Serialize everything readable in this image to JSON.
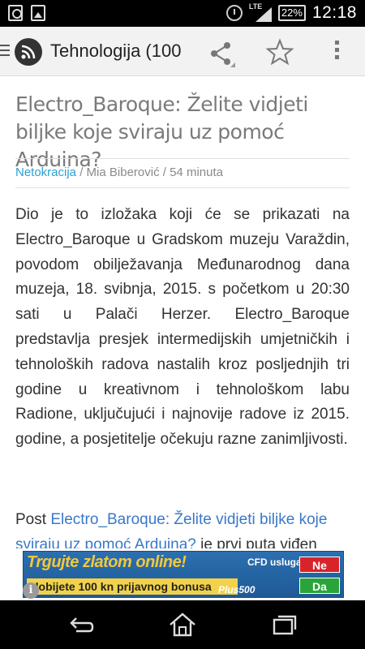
{
  "status_bar": {
    "network": "LTE",
    "battery": "22%",
    "time": "12:18"
  },
  "action_bar": {
    "title": "Tehnologija (100",
    "icons": [
      "rss-feed-icon",
      "share-icon",
      "star-icon",
      "overflow-menu-icon"
    ]
  },
  "article": {
    "title": "Electro_Baroque: Želite vidjeti biljke koje sviraju uz pomoć Arduina?",
    "source": "Netokracija",
    "separator": " / ",
    "author": "Mia Biberović",
    "time_ago": "54 minuta",
    "body": "Dio je to izložaka koji će se prikazati na Electro_Baroque u Gradskom muzeju Varaždin, povodom obilježavanja Međunarodnog dana muzeja, 18. svibnja, 2015. s početkom u 20:30 sati u Palači Herzer. Electro_Baroque predstavlja presjek intermedijskih umjetničkih i tehnoloških radova nastalih kroz posljednjih tri godine u kreativnom i tehnološkom labu Radione, uključujući i najnovije radove iz 2015. godine, a posjetitelje očekuju razne zanimljivosti.",
    "post_prefix": "Post ",
    "post_link": "Electro_Baroque: Želite vidjeti biljke koje sviraju uz pomoć Arduina?",
    "post_suffix": " je prvi puta viđen"
  },
  "ad": {
    "headline": "Trgujte zlatom online!",
    "bonus": "dobijete 100 kn prijavnog bonusa",
    "cfd": "CFD usluga",
    "brand": "Plus500",
    "no": "Ne",
    "yes": "Da",
    "info": "i"
  },
  "nav_bar": {
    "icons": [
      "back-icon",
      "home-icon",
      "recent-apps-icon"
    ]
  }
}
